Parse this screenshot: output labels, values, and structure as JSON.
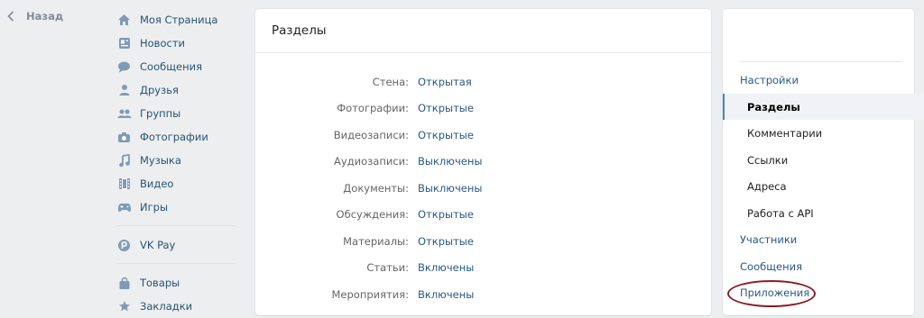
{
  "back": {
    "label": "Назад"
  },
  "nav": {
    "items": [
      {
        "label": "Моя Страница",
        "icon": "home-icon"
      },
      {
        "label": "Новости",
        "icon": "news-icon"
      },
      {
        "label": "Сообщения",
        "icon": "messages-icon"
      },
      {
        "label": "Друзья",
        "icon": "friends-icon"
      },
      {
        "label": "Группы",
        "icon": "groups-icon"
      },
      {
        "label": "Фотографии",
        "icon": "camera-icon"
      },
      {
        "label": "Музыка",
        "icon": "music-icon"
      },
      {
        "label": "Видео",
        "icon": "video-icon"
      },
      {
        "label": "Игры",
        "icon": "games-icon"
      }
    ],
    "vkpay": {
      "label": "VK Pay",
      "icon": "vkpay-icon"
    },
    "extra": [
      {
        "label": "Товары",
        "icon": "goods-icon"
      },
      {
        "label": "Закладки",
        "icon": "bookmarks-icon"
      }
    ]
  },
  "main": {
    "title": "Разделы",
    "rows": [
      {
        "label": "Стена:",
        "value": "Открытая"
      },
      {
        "label": "Фотографии:",
        "value": "Открытые"
      },
      {
        "label": "Видеозаписи:",
        "value": "Открытые"
      },
      {
        "label": "Аудиозаписи:",
        "value": "Выключены"
      },
      {
        "label": "Документы:",
        "value": "Выключены"
      },
      {
        "label": "Обсуждения:",
        "value": "Открытые"
      },
      {
        "label": "Материалы:",
        "value": "Открытые"
      },
      {
        "label": "Статьи:",
        "value": "Включены"
      },
      {
        "label": "Мероприятия:",
        "value": "Включены"
      }
    ]
  },
  "right_menu": {
    "settings": "Настройки",
    "sections": "Разделы",
    "comments": "Комментарии",
    "links": "Ссылки",
    "addresses": "Адреса",
    "api": "Работа с API",
    "members": "Участники",
    "messages": "Сообщения",
    "apps": "Приложения"
  },
  "colors": {
    "accent": "#5181b8",
    "link": "#2a5885",
    "highlight": "#8a1c24"
  }
}
